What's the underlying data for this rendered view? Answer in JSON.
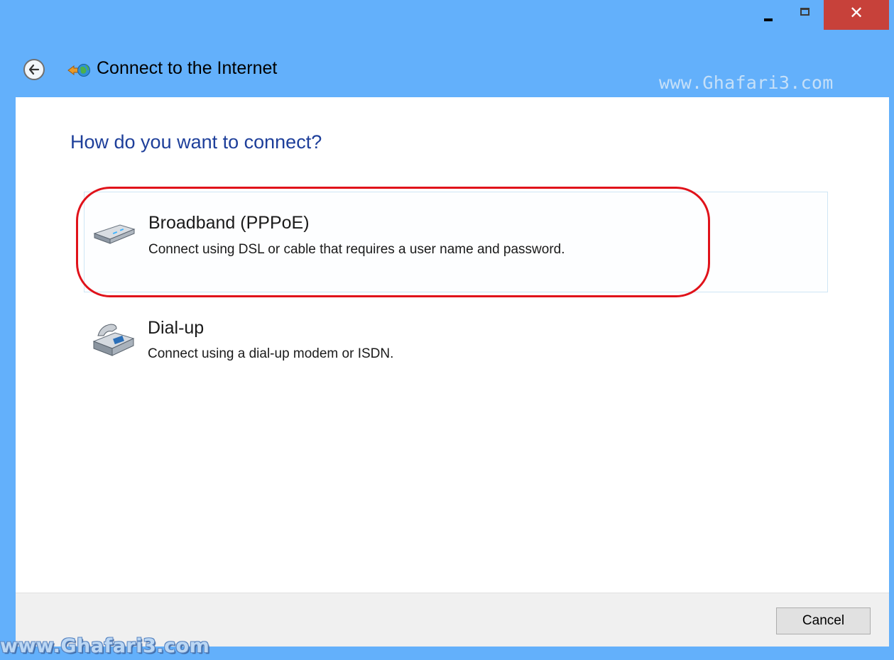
{
  "window": {
    "title": "Connect to the Internet",
    "controls": {
      "minimize": "minimize",
      "maximize": "maximize",
      "close_glyph": "✕"
    }
  },
  "watermark": {
    "top": "www.Ghafari3.com",
    "bottom": "www.Ghafari3.com"
  },
  "content": {
    "heading": "How do you want to connect?",
    "options": [
      {
        "title": "Broadband (PPPoE)",
        "description": "Connect using DSL or cable that requires a user name and password.",
        "icon": "broadband-modem-icon",
        "highlighted": true
      },
      {
        "title": "Dial-up",
        "description": "Connect using a dial-up modem or ISDN.",
        "icon": "dialup-phone-icon",
        "highlighted": false
      }
    ]
  },
  "footer": {
    "cancel_label": "Cancel"
  },
  "colors": {
    "titlebar": "#63b0fb",
    "heading": "#1e3f9a",
    "close_button": "#c7413a",
    "highlight_ring": "#e0121a"
  }
}
